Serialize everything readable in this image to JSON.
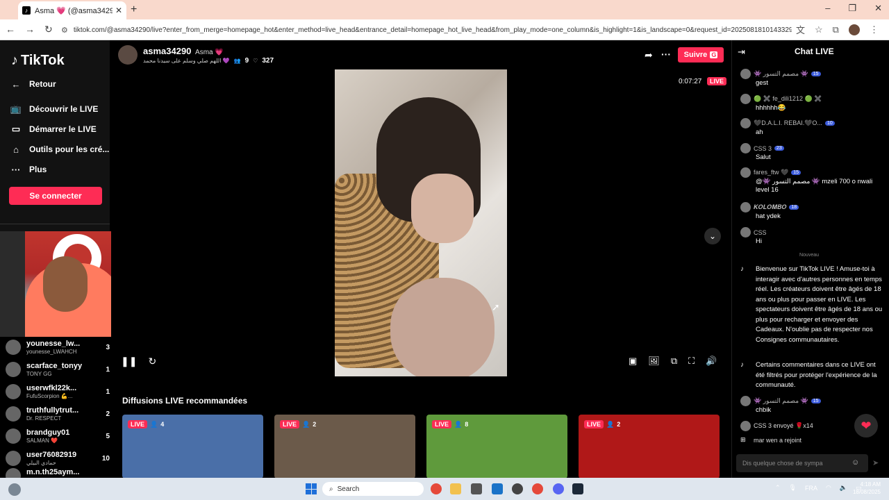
{
  "browser": {
    "tab_title": "Asma 💗 (@asma34290) e",
    "url": "tiktok.com/@asma34290/live?enter_from_merge=homepage_hot&enter_method=live_head&entrance_detail=homepage_hot_live_head&from_play_mode=one_column&is_highlight=1&is_landscape=0&request_id=2025081810143329287A3CA47..."
  },
  "sidebar": {
    "logo": "TikTok",
    "items": [
      {
        "label": "Retour",
        "icon": "arrow-left-icon"
      },
      {
        "label": "Découvrir le LIVE",
        "icon": "tv-icon"
      },
      {
        "label": "Démarrer le LIVE",
        "icon": "camera-icon"
      },
      {
        "label": "Outils pour les cré...",
        "icon": "home-icon"
      },
      {
        "label": "Plus",
        "icon": "more-icon"
      }
    ],
    "login_label": "Se connecter"
  },
  "viewers": [
    {
      "name": "younesse_lw...",
      "sub": "younesse_LWAHCH",
      "count": "3"
    },
    {
      "name": "scarface_tonyy",
      "sub": "TONY GG",
      "count": "1"
    },
    {
      "name": "userwfkl22k...",
      "sub": "FufuScorpion 💪...",
      "count": "1"
    },
    {
      "name": "truthfullytrut...",
      "sub": "Dr. RESPECT",
      "count": "2"
    },
    {
      "name": "brandguy01",
      "sub": "SALMAN ❤️",
      "count": "5"
    },
    {
      "name": "user76082919",
      "sub": "حمادي البيلي",
      "count": "10"
    },
    {
      "name": "m.n.th25aym...",
      "sub": "",
      "count": ""
    }
  ],
  "host": {
    "username": "asma34290",
    "display": "Asma 💗",
    "bio": "اللهم صلي وسلم على سيدنا محمد 💜",
    "viewers": "9",
    "likes": "327",
    "follow_label": "Suivre",
    "follow_key": "G"
  },
  "player": {
    "timer": "0:07:27",
    "live_label": "LIVE"
  },
  "recommended": {
    "title": "Diffusions LIVE recommandées",
    "cards": [
      {
        "live": "LIVE",
        "viewers": "4",
        "color": "#4a6fa8"
      },
      {
        "live": "LIVE",
        "viewers": "2",
        "color": "#6b5a4a"
      },
      {
        "live": "LIVE",
        "viewers": "8",
        "color": "#5f9a3c"
      },
      {
        "live": "LIVE",
        "viewers": "2",
        "color": "#b01818"
      }
    ]
  },
  "chat": {
    "title": "Chat LIVE",
    "messages": [
      {
        "user": "👾 مصمم التسور 👾",
        "level": "15",
        "text": "gest"
      },
      {
        "user": "🟢 ✖️ fe_dili1212 🟢 ✖️",
        "level": "",
        "text": "hhhhhh😂"
      },
      {
        "user": "🖤D.A.L.I. REBAI.🖤O...",
        "level": "10",
        "text": "ah"
      },
      {
        "user": "CSS 3",
        "level": "23",
        "text": "Salut"
      },
      {
        "user": "fares_ftw 🖤",
        "level": "15",
        "text": "@👾 مصمم التسور 👾 mzeli 700 o nwali level 16"
      },
      {
        "user": "𝑲𝑶𝑳𝑶𝑴𝑩𝑶",
        "level": "18",
        "text": "hat ydek"
      },
      {
        "user": "CSS",
        "level": "",
        "text": "Hi"
      }
    ],
    "nouveau": "Nouveau",
    "system1": "Bienvenue sur TikTok LIVE ! Amuse-toi à interagir avec d'autres personnes en temps réel. Les créateurs doivent être âgés de 18 ans ou plus pour passer en LIVE. Les spectateurs doivent être âgés de 18 ans ou plus pour recharger et envoyer des Cadeaux. N'oublie pas de respecter nos Consignes communautaires.",
    "system2": "Certains commentaires dans ce LIVE ont été filtrés pour protéger l'expérience de la communauté.",
    "last": {
      "user": "👾 مصمم التسور 👾",
      "level": "15",
      "text": "chbik"
    },
    "gift": "CSS 3 envoyé 🌹x14",
    "joined": "mar wen a rejoint",
    "input_placeholder": "Dis quelque chose de sympa"
  },
  "taskbar": {
    "search": "Search",
    "lang": "FRA",
    "time": "4:18 AM",
    "date": "18/08/2025"
  },
  "colors": {
    "accent": "#fe2c55",
    "level_badge": "#3b5bdb"
  }
}
